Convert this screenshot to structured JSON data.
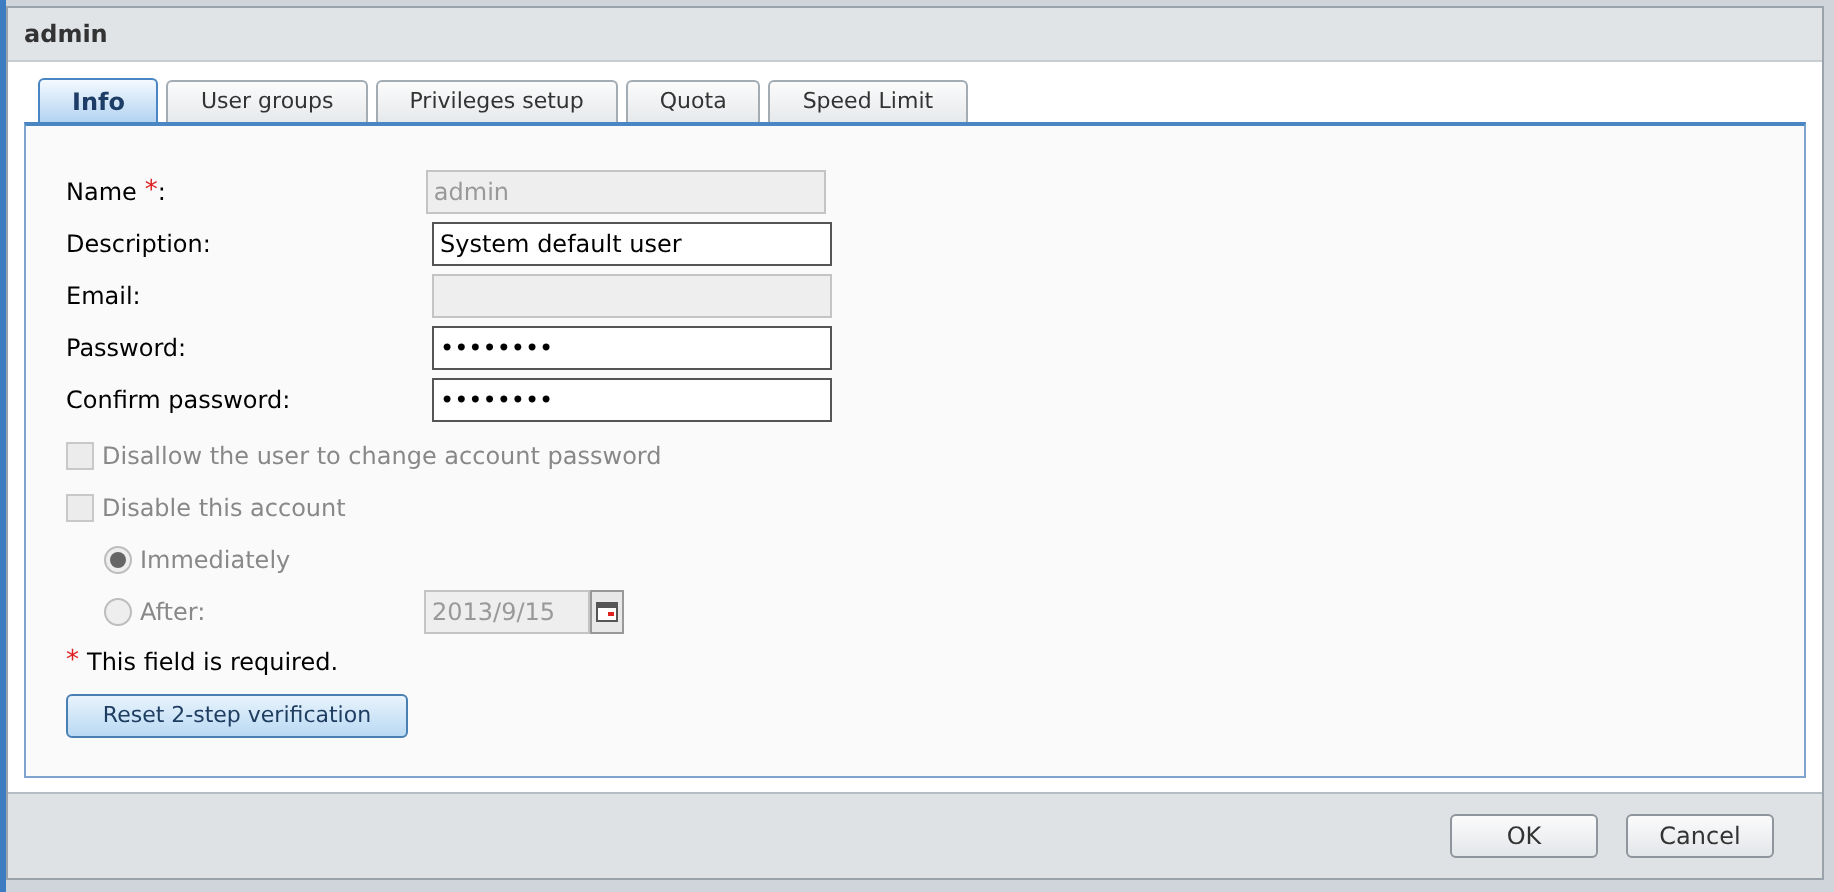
{
  "window": {
    "title": "admin"
  },
  "tabs": [
    {
      "label": "Info",
      "selected": true
    },
    {
      "label": "User groups",
      "selected": false
    },
    {
      "label": "Privileges setup",
      "selected": false
    },
    {
      "label": "Quota",
      "selected": false
    },
    {
      "label": "Speed Limit",
      "selected": false
    }
  ],
  "fields": [
    {
      "label": "Name",
      "required": true,
      "suffix": ":",
      "value": "admin",
      "disabled": true
    },
    {
      "label": "Description:",
      "required": false,
      "value": "System default user",
      "disabled": false
    },
    {
      "label": "Email:",
      "required": false,
      "disabled": true
    },
    {
      "label": "Password:",
      "required": false,
      "value": "••••••••",
      "disabled": false
    },
    {
      "label": "Confirm password:",
      "required": false,
      "value": "••••••••",
      "disabled": false
    }
  ],
  "options": [
    {
      "kind": "checkbox",
      "label": "Disallow the user to change account password",
      "checked": false,
      "disabled": true
    },
    {
      "kind": "checkbox",
      "label": "Disable this account",
      "checked": false,
      "disabled": true
    },
    {
      "kind": "radio",
      "label": "Immediately",
      "selected": true,
      "disabled": true
    },
    {
      "kind": "radio",
      "label": "After:",
      "selected": false,
      "disabled": true,
      "date": "2013/9/15"
    }
  ],
  "required_note": {
    "mark": "*",
    "text": "This field is required."
  },
  "reset_button": "Reset 2-step verification",
  "buttons": [
    "OK",
    "Cancel"
  ]
}
